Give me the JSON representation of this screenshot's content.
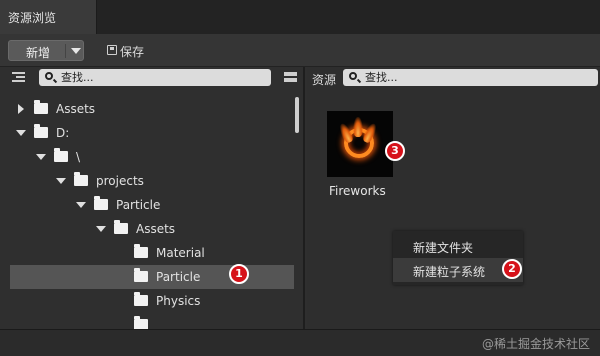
{
  "window": {
    "tab_title": "资源浏览"
  },
  "toolbar": {
    "new_label": "新增",
    "save_label": "保存"
  },
  "left_panel": {
    "search_placeholder": "查找...",
    "tree": [
      {
        "label": "Assets",
        "state": "collapsed"
      },
      {
        "label": "D:",
        "state": "expanded"
      },
      {
        "label": "\\",
        "state": "expanded"
      },
      {
        "label": "projects",
        "state": "expanded"
      },
      {
        "label": "Particle",
        "state": "expanded"
      },
      {
        "label": "Assets",
        "state": "expanded"
      },
      {
        "label": "Material",
        "state": "leaf"
      },
      {
        "label": "Particle",
        "state": "leaf",
        "selected": true
      },
      {
        "label": "Physics",
        "state": "leaf"
      }
    ]
  },
  "right_panel": {
    "title": "资源",
    "search_placeholder": "查找...",
    "assets": [
      {
        "name": "Fireworks",
        "icon": "fire-ring-thumbnail"
      }
    ]
  },
  "context_menu": {
    "items": [
      {
        "label": "新建文件夹"
      },
      {
        "label": "新建粒子系统"
      }
    ]
  },
  "badges": {
    "b1": "1",
    "b2": "2",
    "b3": "3"
  },
  "footer": {
    "watermark": "@稀土掘金技术社区"
  },
  "colors": {
    "badge": "#d6121a",
    "selected_row": "#555555"
  }
}
